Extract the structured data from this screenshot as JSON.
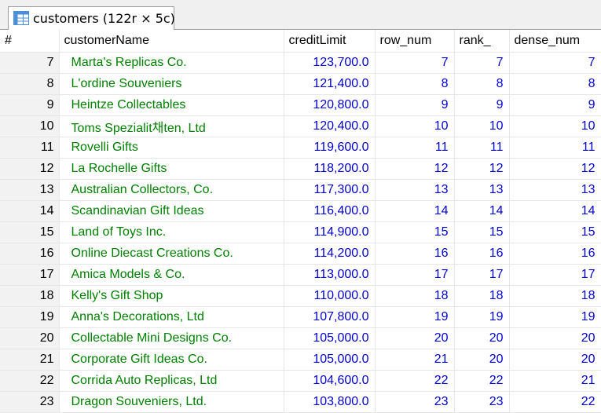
{
  "tab": {
    "title": "customers (122r × 5c)",
    "icon": "table-grid-icon"
  },
  "colors": {
    "name_text": "#008000",
    "number_text": "#0000d0",
    "rownum_bg": "#f2f2f2"
  },
  "columns": [
    "#",
    "customerName",
    "creditLimit",
    "row_num",
    "rank_",
    "dense_num"
  ],
  "rows": [
    [
      "7",
      "Marta's Replicas Co.",
      "123,700.0",
      "7",
      "7",
      "7"
    ],
    [
      "8",
      "L'ordine Souveniers",
      "121,400.0",
      "8",
      "8",
      "8"
    ],
    [
      "9",
      "Heintze Collectables",
      "120,800.0",
      "9",
      "9",
      "9"
    ],
    [
      "10",
      "Toms Spezialit채ten, Ltd",
      "120,400.0",
      "10",
      "10",
      "10"
    ],
    [
      "11",
      "Rovelli Gifts",
      "119,600.0",
      "11",
      "11",
      "11"
    ],
    [
      "12",
      "La Rochelle Gifts",
      "118,200.0",
      "12",
      "12",
      "12"
    ],
    [
      "13",
      "Australian Collectors, Co.",
      "117,300.0",
      "13",
      "13",
      "13"
    ],
    [
      "14",
      "Scandinavian Gift Ideas",
      "116,400.0",
      "14",
      "14",
      "14"
    ],
    [
      "15",
      "Land of Toys Inc.",
      "114,900.0",
      "15",
      "15",
      "15"
    ],
    [
      "16",
      "Online Diecast Creations Co.",
      "114,200.0",
      "16",
      "16",
      "16"
    ],
    [
      "17",
      "Amica Models & Co.",
      "113,000.0",
      "17",
      "17",
      "17"
    ],
    [
      "18",
      "Kelly's Gift Shop",
      "110,000.0",
      "18",
      "18",
      "18"
    ],
    [
      "19",
      "Anna's Decorations, Ltd",
      "107,800.0",
      "19",
      "19",
      "19"
    ],
    [
      "20",
      "Collectable Mini Designs Co.",
      "105,000.0",
      "20",
      "20",
      "20"
    ],
    [
      "21",
      "Corporate Gift Ideas Co.",
      "105,000.0",
      "21",
      "20",
      "20"
    ],
    [
      "22",
      "Corrida Auto Replicas, Ltd",
      "104,600.0",
      "22",
      "22",
      "21"
    ],
    [
      "23",
      "Dragon Souveniers, Ltd.",
      "103,800.0",
      "23",
      "23",
      "22"
    ]
  ]
}
